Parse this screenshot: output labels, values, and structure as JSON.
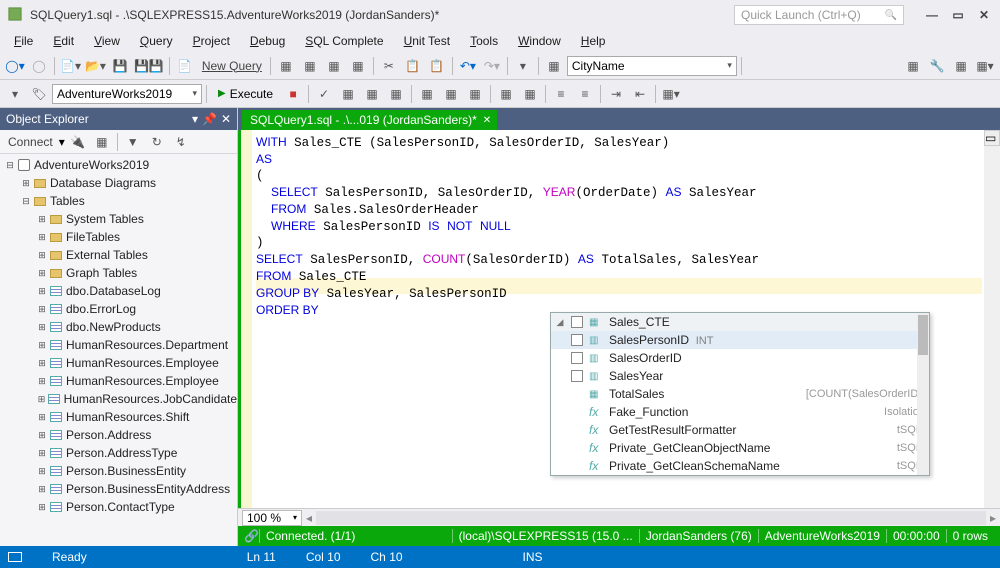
{
  "title": "SQLQuery1.sql - .\\SQLEXPRESS15.AdventureWorks2019 (JordanSanders)*",
  "quick_launch_placeholder": "Quick Launch (Ctrl+Q)",
  "menu": [
    "File",
    "Edit",
    "View",
    "Query",
    "Project",
    "Debug",
    "SQL Complete",
    "Unit Test",
    "Tools",
    "Window",
    "Help"
  ],
  "toolbar": {
    "new_query": "New Query",
    "db_dropdown": "AdventureWorks2019",
    "combo_right": "CityName",
    "execute": "Execute"
  },
  "sidebar": {
    "title": "Object Explorer",
    "connect": "Connect",
    "root": "AdventureWorks2019",
    "folders": [
      "Database Diagrams",
      "Tables"
    ],
    "subfolders": [
      "System Tables",
      "FileTables",
      "External Tables",
      "Graph Tables"
    ],
    "tables": [
      "dbo.DatabaseLog",
      "dbo.ErrorLog",
      "dbo.NewProducts",
      "HumanResources.Department",
      "HumanResources.Employee",
      "HumanResources.Employee",
      "HumanResources.JobCandidate",
      "HumanResources.Shift",
      "Person.Address",
      "Person.AddressType",
      "Person.BusinessEntity",
      "Person.BusinessEntityAddress",
      "Person.ContactType"
    ]
  },
  "editor": {
    "tab": "SQLQuery1.sql - .\\...019 (JordanSanders)*",
    "code_lines": [
      "WITH Sales_CTE (SalesPersonID, SalesOrderID, SalesYear)",
      "AS",
      "(",
      "  SELECT SalesPersonID, SalesOrderID, YEAR(OrderDate) AS SalesYear",
      "  FROM Sales.SalesOrderHeader",
      "  WHERE SalesPersonID IS NOT NULL",
      ")",
      "SELECT SalesPersonID, COUNT(SalesOrderID) AS TotalSales, SalesYear",
      "FROM Sales_CTE",
      "GROUP BY SalesYear, SalesPersonID",
      "ORDER BY "
    ],
    "zoom": "100 %",
    "autocomplete": {
      "header": "Sales_CTE",
      "items": [
        {
          "label": "SalesPersonID",
          "type": "INT",
          "sel": true,
          "chk": true
        },
        {
          "label": "SalesOrderID",
          "chk": true
        },
        {
          "label": "SalesYear",
          "chk": true
        },
        {
          "label": "TotalSales",
          "hint": "[COUNT(SalesOrderID)]",
          "icon": "col"
        },
        {
          "label": "Fake_Function",
          "hint": "Isolation",
          "icon": "fx"
        },
        {
          "label": "GetTestResultFormatter",
          "hint": "tSQLt",
          "icon": "fx"
        },
        {
          "label": "Private_GetCleanObjectName",
          "hint": "tSQLt",
          "icon": "fx"
        },
        {
          "label": "Private_GetCleanSchemaName",
          "hint": "tSQLt",
          "icon": "fx"
        }
      ]
    }
  },
  "status_editor": {
    "conn": "Connected. (1/1)",
    "server": "(local)\\SQLEXPRESS15 (15.0 ...",
    "user": "JordanSanders (76)",
    "db": "AdventureWorks2019",
    "time": "00:00:00",
    "rows": "0 rows"
  },
  "status_main": {
    "ready": "Ready",
    "ln": "Ln 11",
    "col": "Col 10",
    "ch": "Ch 10",
    "ins": "INS"
  }
}
